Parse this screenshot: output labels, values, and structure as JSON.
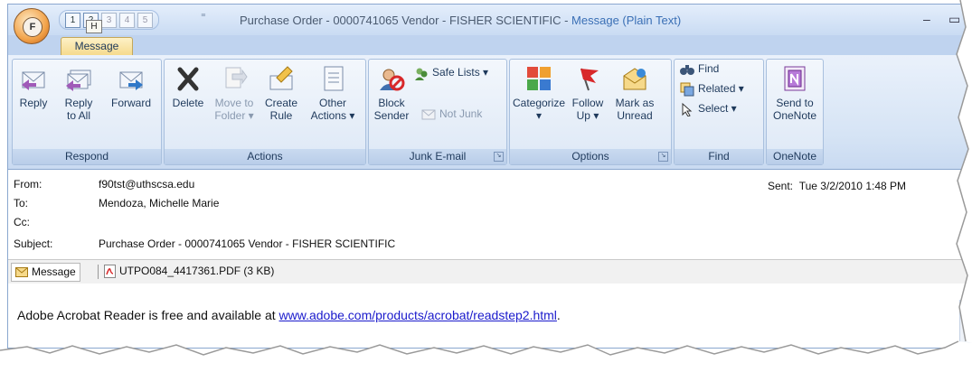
{
  "titlebar": {
    "title_main": "Purchase Order - 0000741065   Vendor - FISHER SCIENTIFIC - ",
    "title_type": "Message (Plain Text)",
    "minimize": "–",
    "maximize": "▭",
    "qat_keys": [
      "1",
      "2",
      "3",
      "4",
      "5"
    ],
    "qat_arrow": "⁼",
    "office_key": "F"
  },
  "tabs": {
    "message_label": "Message",
    "keytip": "H"
  },
  "ribbon": {
    "respond": {
      "label": "Respond",
      "reply": "Reply",
      "reply_all_1": "Reply",
      "reply_all_2": "to All",
      "forward": "Forward"
    },
    "actions": {
      "label": "Actions",
      "delete": "Delete",
      "move_1": "Move to",
      "move_2": "Folder ▾",
      "create_1": "Create",
      "create_2": "Rule",
      "other_1": "Other",
      "other_2": "Actions ▾"
    },
    "junk": {
      "label": "Junk E-mail",
      "block_1": "Block",
      "block_2": "Sender",
      "safe_lists": "Safe Lists ▾",
      "not_junk": "Not Junk"
    },
    "options": {
      "label": "Options",
      "categorize_1": "Categorize",
      "categorize_2": "▾",
      "follow_1": "Follow",
      "follow_2": "Up ▾",
      "mark_1": "Mark as",
      "mark_2": "Unread"
    },
    "find": {
      "label": "Find",
      "find": "Find",
      "related": "Related ▾",
      "select": "Select ▾"
    },
    "onenote": {
      "label": "OneNote",
      "send_1": "Send to",
      "send_2": "OneNote"
    },
    "launcher": "↘"
  },
  "header": {
    "from_label": "From:",
    "from_value": "f90tst@uthscsa.edu",
    "to_label": "To:",
    "to_value": "Mendoza, Michelle Marie",
    "cc_label": "Cc:",
    "cc_value": "",
    "subject_label": "Subject:",
    "subject_value": "Purchase Order - 0000741065   Vendor - FISHER SCIENTIFIC",
    "sent_label": "Sent:",
    "sent_value": "Tue 3/2/2010 1:48 PM"
  },
  "attachments": {
    "message_tab": "Message",
    "file": "UTPO084_4417361.PDF (3 KB)"
  },
  "body": {
    "text": "Adobe Acrobat Reader is free and available at ",
    "link": "www.adobe.com/products/acrobat/readstep2.html",
    "after": "."
  },
  "colors": {
    "ribbon_text": "#1e395b",
    "accent": "#3a6fb5",
    "link": "#1a1acc",
    "tab_active": "#f5d98a"
  }
}
